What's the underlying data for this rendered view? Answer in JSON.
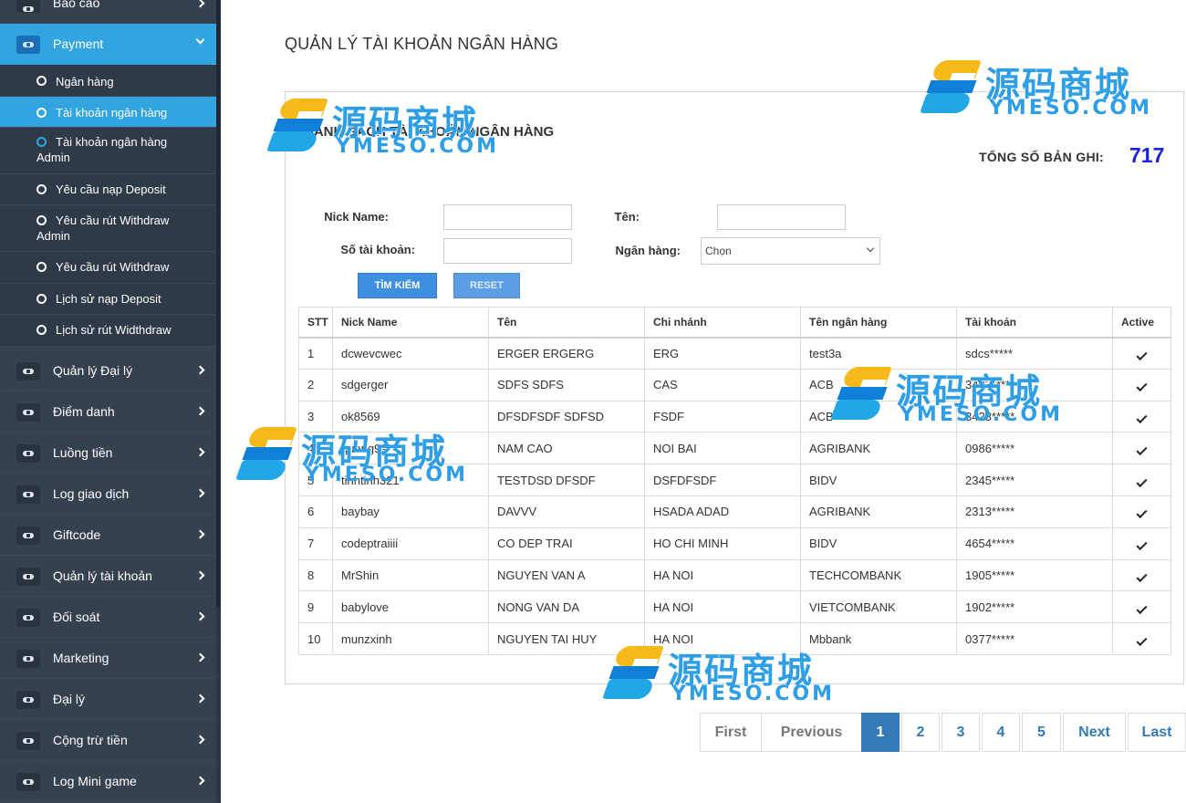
{
  "sidebar": {
    "top_item": {
      "label": "Báo cáo"
    },
    "payment": {
      "label": "Payment"
    },
    "submenu": [
      {
        "label": "Ngân hàng"
      },
      {
        "label": "Tài khoản ngân hàng"
      },
      {
        "label": "Tài khoản ngân hàng",
        "label2": "Admin"
      },
      {
        "label": "Yêu cầu nạp Deposit"
      },
      {
        "label": "Yêu cầu rút Withdraw",
        "label2": "Admin"
      },
      {
        "label": "Yêu cầu rút Withdraw"
      },
      {
        "label": "Lịch sử nạp Deposit"
      },
      {
        "label": "Lịch sử rút Widthdraw"
      }
    ],
    "items": [
      {
        "label": "Quản lý Đại lý"
      },
      {
        "label": "Điểm danh"
      },
      {
        "label": "Luồng tiền"
      },
      {
        "label": "Log giao dịch"
      },
      {
        "label": "Giftcode"
      },
      {
        "label": "Quản lý tài khoản"
      },
      {
        "label": "Đối soát"
      },
      {
        "label": "Marketing"
      },
      {
        "label": "Đại lý"
      },
      {
        "label": "Cộng trừ tiền"
      },
      {
        "label": "Log Mini game"
      }
    ]
  },
  "page": {
    "title": "QUẢN LÝ TÀI KHOẢN NGÂN HÀNG",
    "panel_title": "DANH SÁCH TÀI KHOẢN NGÂN HÀNG",
    "total_label": "TỔNG SỐ BẢN GHI:",
    "total_value": "717"
  },
  "filters": {
    "nick_name_label": "Nick Name:",
    "nick_name_value": "",
    "ten_label": "Tên:",
    "ten_value": "",
    "so_tai_khoan_label": "Số tài khoản:",
    "so_tai_khoan_value": "",
    "ngan_hang_label": "Ngân hàng:",
    "ngan_hang_selected": "Chọn",
    "search_button": "TÌM KIẾM",
    "reset_button": "RESET"
  },
  "table": {
    "headers": [
      "STT",
      "Nick Name",
      "Tên",
      "Chi nhánh",
      "Tên ngân hàng",
      "Tài khoản",
      "Active"
    ],
    "rows": [
      [
        "1",
        "dcwevcwec",
        "ERGER ERGERG",
        "ERG",
        "test3a",
        "sdcs*****"
      ],
      [
        "2",
        "sdgerger",
        "SDFS SDFS",
        "CAS",
        "ACB",
        "3423*****"
      ],
      [
        "3",
        "ok8569",
        "DFSDFSDF SDFSD",
        "FSDF",
        "ACB",
        "3423*****"
      ],
      [
        "4",
        "quang99",
        "NAM CAO",
        "NOI BAI",
        "AGRIBANK",
        "0986*****"
      ],
      [
        "5",
        "tinhtinh321",
        "TESTDSD DFSDF",
        "DSFDFSDF",
        "BIDV",
        "2345*****"
      ],
      [
        "6",
        "baybay",
        "DAVVV",
        "HSADA ADAD",
        "AGRIBANK",
        "2313*****"
      ],
      [
        "7",
        "codeptraiiii",
        "CO DEP TRAI",
        "HO CHI MINH",
        "BIDV",
        "4654*****"
      ],
      [
        "8",
        "MrShin",
        "NGUYEN VAN A",
        "HA NOI",
        "TECHCOMBANK",
        "1905*****"
      ],
      [
        "9",
        "babylove",
        "NONG VAN DA",
        "HA NOI",
        "VIETCOMBANK",
        "1902*****"
      ],
      [
        "10",
        "munzxinh",
        "NGUYEN TAI HUY",
        "HA NOI",
        "Mbbank",
        "0377*****"
      ]
    ]
  },
  "pagination": {
    "first": "First",
    "previous": "Previous",
    "pages": [
      "1",
      "2",
      "3",
      "4",
      "5"
    ],
    "current": "1",
    "next": "Next",
    "last": "Last"
  },
  "watermark": {
    "cn": "源码商城",
    "en": "YMESO.COM"
  },
  "colors": {
    "sidebar_bg": "#364150",
    "active_blue": "#32a5e1",
    "total_value": "#1a23d6",
    "link_blue": "#337ab7"
  }
}
